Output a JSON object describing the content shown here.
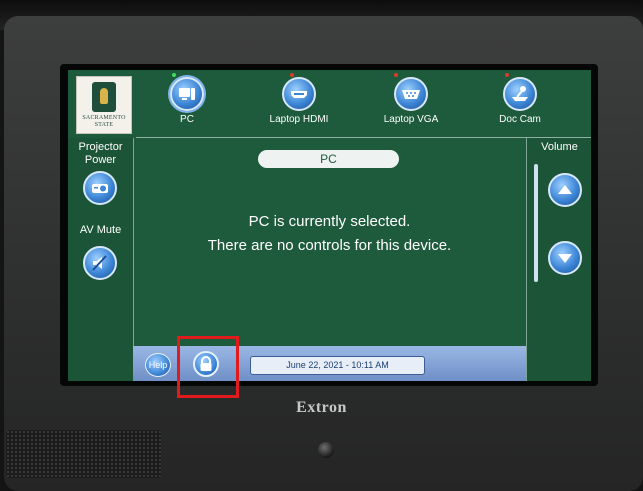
{
  "logo": {
    "lines": [
      "SACRAMENTO",
      "STATE"
    ]
  },
  "sources": [
    {
      "label": "PC",
      "icon": "pc-icon",
      "status": "green",
      "active": true
    },
    {
      "label": "Laptop HDMI",
      "icon": "hdmi-icon",
      "status": "red",
      "active": false
    },
    {
      "label": "Laptop VGA",
      "icon": "vga-icon",
      "status": "red",
      "active": false
    },
    {
      "label": "Doc Cam",
      "icon": "doc-cam-icon",
      "status": "red",
      "active": false
    }
  ],
  "left_panel": {
    "projector_power_label": "Projector Power",
    "av_mute_label": "AV Mute"
  },
  "right_panel": {
    "volume_label": "Volume"
  },
  "main": {
    "title": "PC",
    "message_line1": "PC is currently selected.",
    "message_line2": "There are no controls for this device."
  },
  "bottom_bar": {
    "help_label": "Help",
    "datetime": "June 22, 2021  -  10:11 AM"
  },
  "device": {
    "brand": "Extron"
  },
  "colors": {
    "screen_green": "#1e5a3c",
    "button_blue": "#3d86d6",
    "highlight_red": "#e11b1b"
  }
}
